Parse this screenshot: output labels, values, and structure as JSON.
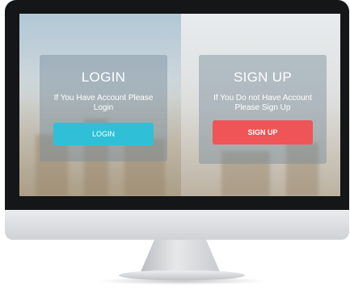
{
  "login_panel": {
    "title": "LOGIN",
    "text": "If You Have Account Please Login",
    "button_label": "LOGIN"
  },
  "signup_panel": {
    "title": "SIGN UP",
    "text": "If You Do not Have Account Please Sign Up",
    "button_label": "SIGN UP"
  },
  "colors": {
    "login_button": "#2fc0d8",
    "signup_button": "#ef5457",
    "panel_text": "#ffffff"
  }
}
